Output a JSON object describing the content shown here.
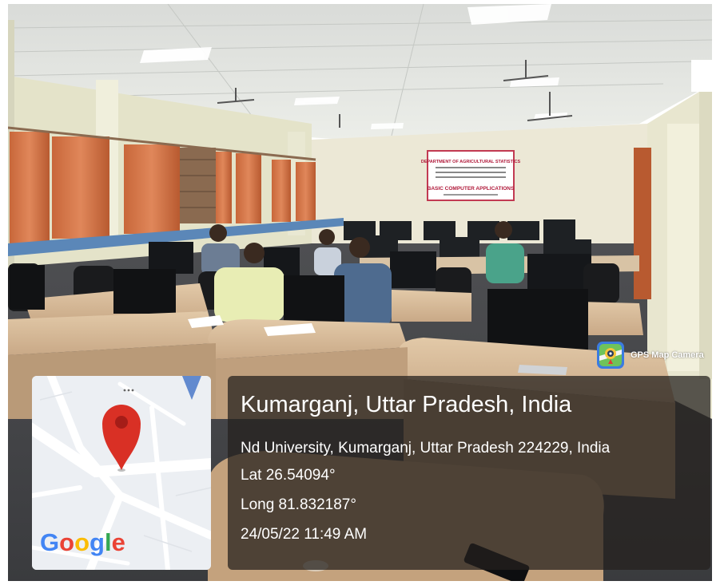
{
  "banner": {
    "line1": "DEPARTMENT OF AGRICULTURAL STATISTICS",
    "line2": "BASIC COMPUTER APPLICATIONS"
  },
  "stamp": {
    "app_name": "GPS Map Camera",
    "icon": "gps-map-camera-icon"
  },
  "map": {
    "brand": "Google",
    "brand_colors": [
      "#4285F4",
      "#EA4335",
      "#FBBC05",
      "#4285F4",
      "#34A853",
      "#EA4335"
    ],
    "pin_color": "#D93025",
    "icon": "location-pin-icon"
  },
  "location": {
    "title": "Kumarganj, Uttar Pradesh, India",
    "address": "Nd University, Kumarganj, Uttar Pradesh 224229, India",
    "lat": "Lat 26.54094°",
    "long": "Long 81.832187°",
    "datetime": "24/05/22 11:49 AM"
  }
}
